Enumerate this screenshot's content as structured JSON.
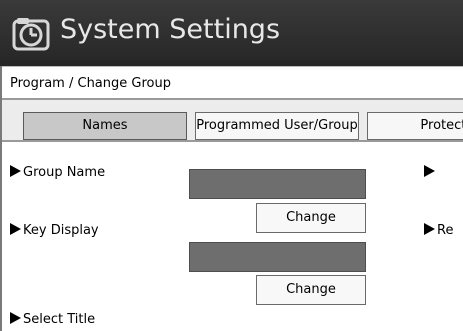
{
  "window": {
    "title": "System Settings",
    "icon": "clock-icon"
  },
  "breadcrumb": "Program / Change Group",
  "tabs": [
    {
      "label": "Names",
      "selected": true
    },
    {
      "label": "Programmed User/Group",
      "selected": false
    },
    {
      "label": "Protecti",
      "selected": false
    }
  ],
  "rows": [
    {
      "label": "Group Name",
      "button": "Change",
      "right_label": ""
    },
    {
      "label": "Key Display",
      "button": "Change",
      "right_label": "Re"
    },
    {
      "label": "Select Title"
    }
  ]
}
